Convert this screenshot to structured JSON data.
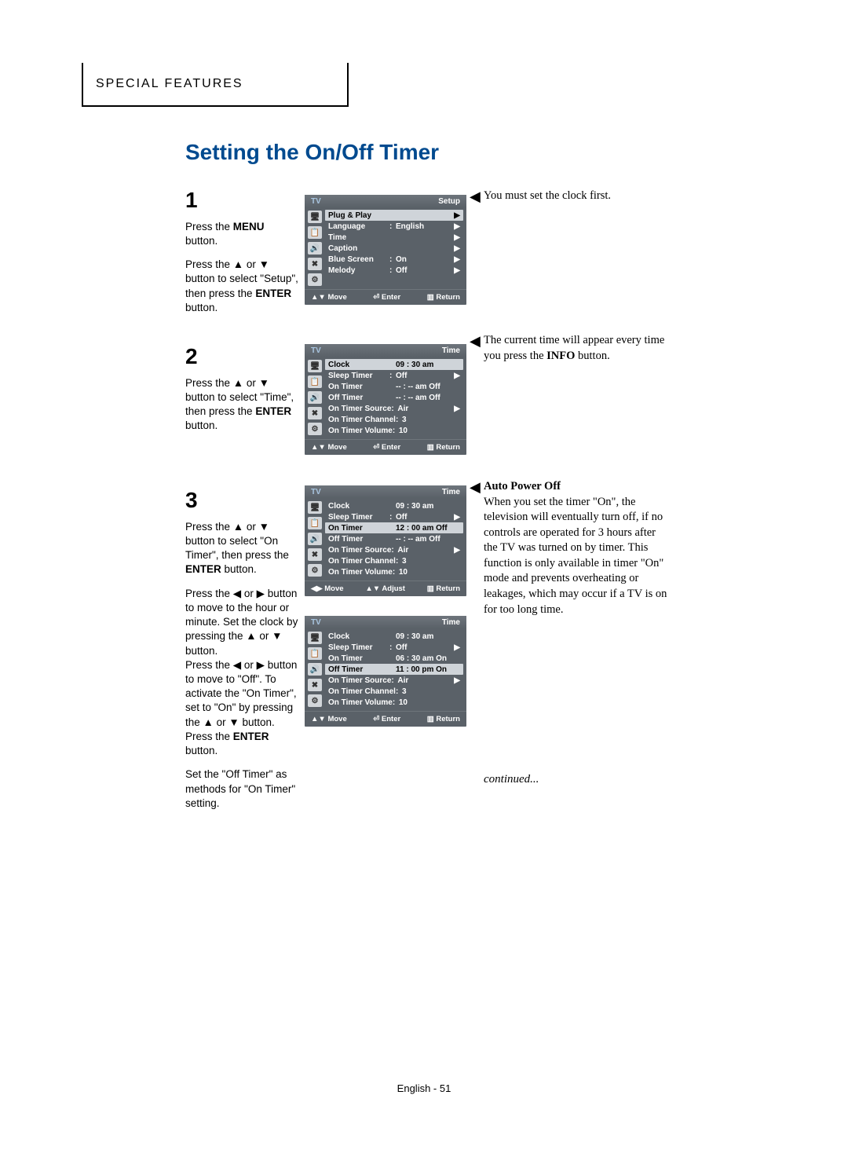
{
  "header": "SPECIAL FEATURES",
  "title": "Setting the On/Off Timer",
  "footer": "English - 51",
  "continued": "continued...",
  "steps": {
    "s1": {
      "num": "1",
      "p1a": "Press the ",
      "p1b": "MENU",
      "p1c": " button.",
      "p2a": "Press the ▲ or ▼ button to select \"Setup\", then press the ",
      "p2b": "ENTER",
      "p2c": " button."
    },
    "s2": {
      "num": "2",
      "p1a": "Press the ▲ or ▼ button to select \"Time\", then press the ",
      "p1b": "ENTER",
      "p1c": " button."
    },
    "s3": {
      "num": "3",
      "p1a": "Press the ▲ or ▼ button to select \"On Timer\", then press the ",
      "p1b": "ENTER",
      "p1c": " button.",
      "p2": "Press the ◀ or ▶ button to move to the hour or minute. Set the clock by pressing the ▲ or ▼ button.",
      "p3a": "Press the ◀ or ▶ button to move to \"Off\". To activate the \"On Timer\", set to \"On\" by pressing the ▲ or ▼ button.",
      "p3p": "Press the ",
      "p3b": "ENTER",
      "p3c": " button.",
      "p4": "Set the \"Off Timer\" as methods for \"On Timer\" setting."
    }
  },
  "notes": {
    "n1": "You must set the clock first.",
    "n2a": "The current time will appear every time you press the ",
    "n2b": "INFO",
    "n2c": " button.",
    "n3h": "Auto Power Off",
    "n3": "When you set the timer \"On\", the television will eventually turn off, if no controls are operated for 3 hours after the TV was turned on by timer. This function is only available in timer \"On\" mode and prevents overheating or leakages, which may occur if a TV is on for too long time."
  },
  "tv": {
    "tvlabel": "TV",
    "foot_move": "Move",
    "foot_enter": "Enter",
    "foot_return": "Return",
    "foot_adjust": "Adjust",
    "icons": [
      "🖥",
      "📋",
      "🔊",
      "✖",
      "⚙"
    ],
    "t1": {
      "title": "Setup",
      "rows": [
        {
          "lbl": "Plug & Play",
          "val": "",
          "arr": "▶",
          "sel": true
        },
        {
          "lbl": "Language",
          "sep": ":",
          "val": "English",
          "arr": "▶"
        },
        {
          "lbl": "Time",
          "val": "",
          "arr": "▶"
        },
        {
          "lbl": "Caption",
          "val": "",
          "arr": "▶"
        },
        {
          "lbl": "Blue Screen",
          "sep": ":",
          "val": "On",
          "arr": "▶"
        },
        {
          "lbl": "Melody",
          "sep": ":",
          "val": "Off",
          "arr": "▶"
        }
      ]
    },
    "t2": {
      "title": "Time",
      "rows": [
        {
          "lbl": "Clock",
          "val": "09 : 30 am",
          "sel": true
        },
        {
          "lbl": "Sleep Timer",
          "sep": ":",
          "val": "Off",
          "arr": "▶"
        },
        {
          "lbl": "On Timer",
          "val": "-- : -- am  Off"
        },
        {
          "lbl": "Off Timer",
          "val": "-- : -- am  Off"
        },
        {
          "lbl": "On Timer Source",
          "sep": ":",
          "val": "Air",
          "arr": "▶"
        },
        {
          "lbl": "On Timer Channel",
          "sep": ":",
          "val": "3"
        },
        {
          "lbl": "On Timer Volume",
          "sep": ":",
          "val": "10"
        }
      ]
    },
    "t3": {
      "title": "Time",
      "rows": [
        {
          "lbl": "Clock",
          "val": "09 : 30 am"
        },
        {
          "lbl": "Sleep Timer",
          "sep": ":",
          "val": "Off",
          "arr": "▶"
        },
        {
          "lbl": "On Timer",
          "val": "12 : 00 am  Off",
          "sel": true
        },
        {
          "lbl": "Off Timer",
          "val": "-- : -- am  Off"
        },
        {
          "lbl": "On Timer Source",
          "sep": ":",
          "val": "Air",
          "arr": "▶"
        },
        {
          "lbl": "On Timer Channel",
          "sep": ":",
          "val": "3"
        },
        {
          "lbl": "On Timer Volume",
          "sep": ":",
          "val": "10"
        }
      ]
    },
    "t4": {
      "title": "Time",
      "rows": [
        {
          "lbl": "Clock",
          "val": "09 : 30 am"
        },
        {
          "lbl": "Sleep Timer",
          "sep": ":",
          "val": "Off",
          "arr": "▶"
        },
        {
          "lbl": "On Timer",
          "val": "06 : 30 am  On"
        },
        {
          "lbl": "Off Timer",
          "val": "11 : 00 pm  On",
          "sel": true
        },
        {
          "lbl": "On Timer Source",
          "sep": ":",
          "val": "Air",
          "arr": "▶"
        },
        {
          "lbl": "On Timer Channel",
          "sep": ":",
          "val": "3"
        },
        {
          "lbl": "On Timer Volume",
          "sep": ":",
          "val": "10"
        }
      ]
    }
  }
}
